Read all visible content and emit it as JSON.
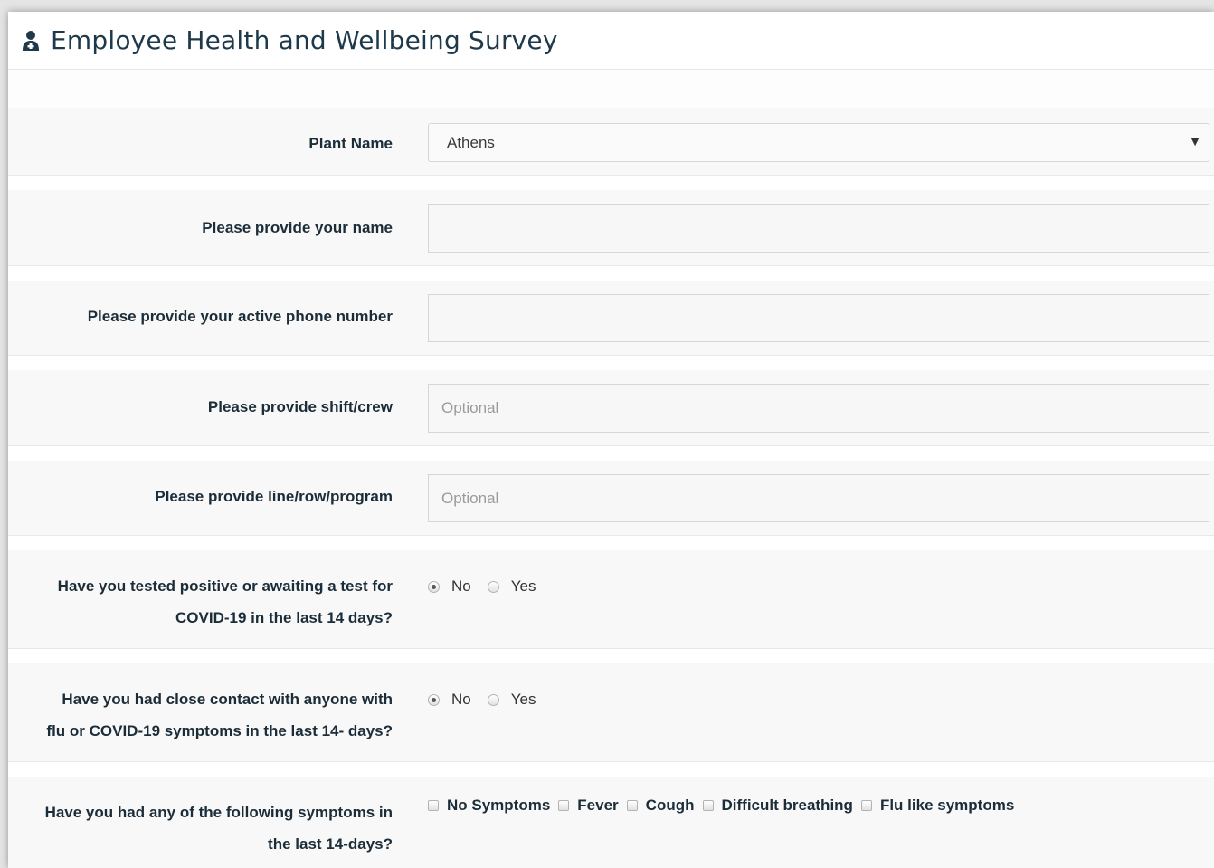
{
  "header": {
    "title": "Employee Health and Wellbeing Survey",
    "icon": "user-doctor-icon"
  },
  "form": {
    "plant": {
      "label": "Plant Name",
      "value": "Athens"
    },
    "name": {
      "label": "Please provide your name",
      "value": "",
      "placeholder": ""
    },
    "phone": {
      "label": "Please provide your active phone number",
      "value": "",
      "placeholder": ""
    },
    "shift": {
      "label": "Please provide shift/crew",
      "placeholder": "Optional"
    },
    "line": {
      "label": "Please provide line/row/program",
      "placeholder": "Optional"
    },
    "tested": {
      "label_line1": "Have you tested positive or awaiting a test for",
      "label_line2": "COVID-19 in the last 14 days?",
      "options": [
        "No",
        "Yes"
      ],
      "selected": "No"
    },
    "contact": {
      "label_line1": "Have you had close contact with anyone with",
      "label_line2": "flu or COVID-19 symptoms in the last 14- days?",
      "options": [
        "No",
        "Yes"
      ],
      "selected": "No"
    },
    "symptoms": {
      "label_line1": "Have you had any of the following symptoms in",
      "label_line2": "the last 14-days?",
      "options": [
        "No Symptoms",
        "Fever",
        "Cough",
        "Difficult breathing",
        "Flu like symptoms"
      ]
    }
  }
}
